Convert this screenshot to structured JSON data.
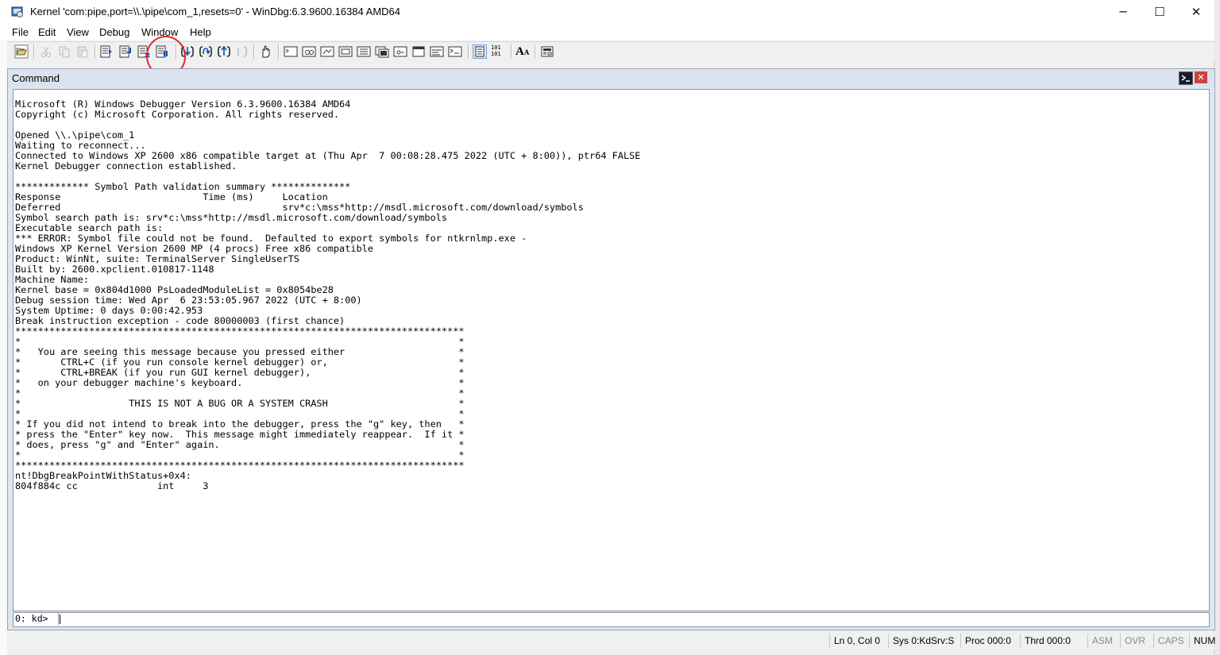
{
  "window": {
    "title": "Kernel 'com:pipe,port=\\\\.\\pipe\\com_1,resets=0' - WinDbg:6.3.9600.16384 AMD64",
    "minimize_glyph": "─",
    "maximize_glyph": "☐",
    "close_glyph": "✕"
  },
  "menu": {
    "items": [
      "File",
      "Edit",
      "View",
      "Debug",
      "Window",
      "Help"
    ]
  },
  "toolbar": {
    "icons": [
      "open-folder-icon",
      "cut-icon",
      "copy-icon",
      "paste-icon",
      "go-icon",
      "restart-icon",
      "stop-debugging-icon",
      "break-icon",
      "step-into-icon",
      "step-over-icon",
      "step-out-icon",
      "run-to-cursor-icon",
      "insert-breakpoint-icon",
      "command-window-icon",
      "watch-window-icon",
      "locals-window-icon",
      "registers-window-icon",
      "memory-window-icon",
      "call-stack-icon",
      "disassembly-window-icon",
      "scratch-pad-icon",
      "processes-threads-icon",
      "source-mode-icon",
      "hex-mode-icon",
      "font-icon",
      "options-icon"
    ],
    "hex_label": "101\n101",
    "font_label": "A",
    "highlight_color": "#e0272c"
  },
  "command_window": {
    "caption": "Command",
    "output": "Microsoft (R) Windows Debugger Version 6.3.9600.16384 AMD64\nCopyright (c) Microsoft Corporation. All rights reserved.\n\nOpened \\\\.\\pipe\\com_1\nWaiting to reconnect...\nConnected to Windows XP 2600 x86 compatible target at (Thu Apr  7 00:08:28.475 2022 (UTC + 8:00)), ptr64 FALSE\nKernel Debugger connection established.\n\n************* Symbol Path validation summary **************\nResponse                         Time (ms)     Location\nDeferred                                       srv*c:\\mss*http://msdl.microsoft.com/download/symbols\nSymbol search path is: srv*c:\\mss*http://msdl.microsoft.com/download/symbols\nExecutable search path is: \n*** ERROR: Symbol file could not be found.  Defaulted to export symbols for ntkrnlmp.exe - \nWindows XP Kernel Version 2600 MP (4 procs) Free x86 compatible\nProduct: WinNt, suite: TerminalServer SingleUserTS\nBuilt by: 2600.xpclient.010817-1148\nMachine Name:\nKernel base = 0x804d1000 PsLoadedModuleList = 0x8054be28\nDebug session time: Wed Apr  6 23:53:05.967 2022 (UTC + 8:00)\nSystem Uptime: 0 days 0:00:42.953\nBreak instruction exception - code 80000003 (first chance)\n*******************************************************************************\n*                                                                             *\n*   You are seeing this message because you pressed either                    *\n*       CTRL+C (if you run console kernel debugger) or,                       *\n*       CTRL+BREAK (if you run GUI kernel debugger),                          *\n*   on your debugger machine's keyboard.                                      *\n*                                                                             *\n*                   THIS IS NOT A BUG OR A SYSTEM CRASH                       *\n*                                                                             *\n* If you did not intend to break into the debugger, press the \"g\" key, then   *\n* press the \"Enter\" key now.  This message might immediately reappear.  If it *\n* does, press \"g\" and \"Enter\" again.                                          *\n*                                                                             *\n*******************************************************************************\nnt!DbgBreakPointWithStatus+0x4:\n804f884c cc              int     3",
    "prompt": "0: kd>",
    "input_value": ""
  },
  "statusbar": {
    "position": "Ln 0, Col 0",
    "sys": "Sys 0:KdSrv:S",
    "proc": "Proc 000:0",
    "thrd": "Thrd 000:0",
    "asm": "ASM",
    "ovr": "OVR",
    "caps": "CAPS",
    "num": "NUM"
  }
}
